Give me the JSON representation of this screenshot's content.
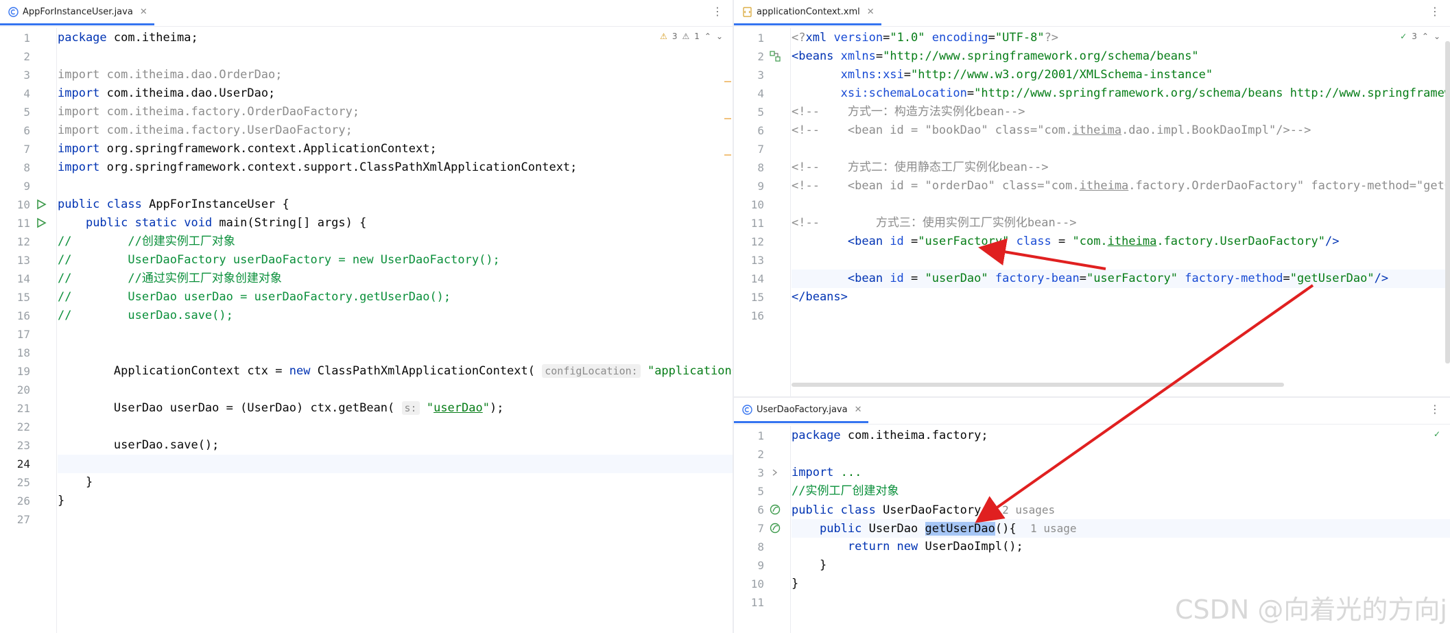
{
  "left": {
    "tab_title": "AppForInstanceUser.java",
    "inspections": {
      "warnings": "3",
      "weak_warnings": "1"
    },
    "lines": [
      {
        "n": "1",
        "segs": [
          [
            "kw",
            "package "
          ],
          [
            "",
            "com.itheima;"
          ]
        ]
      },
      {
        "n": "2",
        "segs": []
      },
      {
        "n": "3",
        "segs": [
          [
            "gray",
            "import com.itheima.dao.OrderDao;"
          ]
        ]
      },
      {
        "n": "4",
        "segs": [
          [
            "kw",
            "import "
          ],
          [
            "",
            "com.itheima.dao.UserDao;"
          ]
        ]
      },
      {
        "n": "5",
        "segs": [
          [
            "gray",
            "import com.itheima.factory.OrderDaoFactory;"
          ]
        ]
      },
      {
        "n": "6",
        "segs": [
          [
            "gray",
            "import com.itheima.factory.UserDaoFactory;"
          ]
        ]
      },
      {
        "n": "7",
        "segs": [
          [
            "kw",
            "import "
          ],
          [
            "",
            "org.springframework.context.ApplicationContext;"
          ]
        ]
      },
      {
        "n": "8",
        "segs": [
          [
            "kw",
            "import "
          ],
          [
            "",
            "org.springframework.context.support.ClassPathXmlApplicationContext;"
          ]
        ]
      },
      {
        "n": "9",
        "segs": []
      },
      {
        "n": "10",
        "segs": [
          [
            "kw",
            "public class "
          ],
          [
            "",
            "AppForInstanceUser {"
          ]
        ]
      },
      {
        "n": "11",
        "segs": [
          [
            "",
            "    "
          ],
          [
            "kw",
            "public static void "
          ],
          [
            "",
            "main(String[] args) {"
          ]
        ]
      },
      {
        "n": "12",
        "segs": [
          [
            "cmtg",
            "//        //创建实例工厂对象"
          ]
        ]
      },
      {
        "n": "13",
        "segs": [
          [
            "cmtg",
            "//        UserDaoFactory userDaoFactory = new UserDaoFactory();"
          ]
        ]
      },
      {
        "n": "14",
        "segs": [
          [
            "cmtg",
            "//        //通过实例工厂对象创建对象"
          ]
        ]
      },
      {
        "n": "15",
        "segs": [
          [
            "cmtg",
            "//        UserDao userDao = userDaoFactory.getUserDao();"
          ]
        ]
      },
      {
        "n": "16",
        "segs": [
          [
            "cmtg",
            "//        userDao.save();"
          ]
        ]
      },
      {
        "n": "17",
        "segs": []
      },
      {
        "n": "18",
        "segs": []
      },
      {
        "n": "19",
        "segs": [
          [
            "",
            "        ApplicationContext ctx = "
          ],
          [
            "kw",
            "new "
          ],
          [
            "",
            "ClassPathXmlApplicationContext( "
          ],
          [
            "hint",
            "configLocation:"
          ],
          [
            "",
            " "
          ],
          [
            "str",
            "\"applicationConte"
          ]
        ]
      },
      {
        "n": "20",
        "segs": []
      },
      {
        "n": "21",
        "segs": [
          [
            "",
            "        UserDao userDao = (UserDao) ctx.getBean( "
          ],
          [
            "hint",
            "s:"
          ],
          [
            "",
            " "
          ],
          [
            "str",
            "\""
          ],
          [
            "str ul",
            "userDao"
          ],
          [
            "str",
            "\""
          ],
          [
            "",
            ");"
          ]
        ]
      },
      {
        "n": "22",
        "segs": []
      },
      {
        "n": "23",
        "segs": [
          [
            "",
            "        userDao.save();"
          ]
        ]
      },
      {
        "n": "24",
        "segs": []
      },
      {
        "n": "25",
        "segs": [
          [
            "",
            "    }"
          ]
        ]
      },
      {
        "n": "26",
        "segs": [
          [
            "",
            "}"
          ]
        ]
      },
      {
        "n": "27",
        "segs": []
      }
    ]
  },
  "xml": {
    "tab_title": "applicationContext.xml",
    "inspections": {
      "ok": "3"
    },
    "lines": [
      {
        "n": "1",
        "segs": [
          [
            "pi",
            "<?"
          ],
          [
            "tag",
            "xml "
          ],
          [
            "attr",
            "version"
          ],
          [
            "",
            "="
          ],
          [
            "str",
            "\"1.0\" "
          ],
          [
            "attr",
            "encoding"
          ],
          [
            "",
            "="
          ],
          [
            "str",
            "\"UTF-8\""
          ],
          [
            "pi",
            "?>"
          ]
        ]
      },
      {
        "n": "2",
        "segs": [
          [
            "tag",
            "<beans "
          ],
          [
            "attr",
            "xmlns"
          ],
          [
            "",
            "="
          ],
          [
            "str",
            "\"http://www.springframework.org/schema/beans\""
          ]
        ]
      },
      {
        "n": "3",
        "segs": [
          [
            "",
            "       "
          ],
          [
            "attr",
            "xmlns:xsi"
          ],
          [
            "",
            "="
          ],
          [
            "str",
            "\"http://www.w3.org/2001/XMLSchema-instance\""
          ]
        ]
      },
      {
        "n": "4",
        "segs": [
          [
            "",
            "       "
          ],
          [
            "attr",
            "xsi:schemaLocation"
          ],
          [
            "",
            "="
          ],
          [
            "str",
            "\"http://www.springframework.org/schema/beans http://www.springframework"
          ]
        ]
      },
      {
        "n": "5",
        "segs": [
          [
            "cmt",
            "<!--    方式一：构造方法实例化bean-->"
          ]
        ]
      },
      {
        "n": "6",
        "segs": [
          [
            "cmt",
            "<!--    <bean id = \"bookDao\" class=\"com."
          ],
          [
            "cmt ul",
            "itheima"
          ],
          [
            "cmt",
            ".dao.impl.BookDaoImpl\"/>-->"
          ]
        ]
      },
      {
        "n": "7",
        "segs": []
      },
      {
        "n": "8",
        "segs": [
          [
            "cmt",
            "<!--    方式二：使用静态工厂实例化bean-->"
          ]
        ]
      },
      {
        "n": "9",
        "segs": [
          [
            "cmt",
            "<!--    <bean id = \"orderDao\" class=\"com."
          ],
          [
            "cmt ul",
            "itheima"
          ],
          [
            "cmt",
            ".factory.OrderDaoFactory\" factory-method=\"getOrde"
          ]
        ]
      },
      {
        "n": "10",
        "segs": []
      },
      {
        "n": "11",
        "segs": [
          [
            "cmt",
            "<!--        方式三：使用实例工厂实例化bean-->"
          ]
        ]
      },
      {
        "n": "12",
        "segs": [
          [
            "",
            "        "
          ],
          [
            "tag",
            "<bean "
          ],
          [
            "attr",
            "id "
          ],
          [
            "",
            "="
          ],
          [
            "str",
            "\"userFactory\" "
          ],
          [
            "attr",
            "class "
          ],
          [
            "",
            "= "
          ],
          [
            "str",
            "\"com."
          ],
          [
            "str ul",
            "itheima"
          ],
          [
            "str",
            ".factory.UserDaoFactory\""
          ],
          [
            "tag",
            "/>"
          ]
        ]
      },
      {
        "n": "13",
        "segs": []
      },
      {
        "n": "14",
        "segs": [
          [
            "",
            "        "
          ],
          [
            "tag",
            "<bean "
          ],
          [
            "attr",
            "id "
          ],
          [
            "",
            "= "
          ],
          [
            "str",
            "\"userDao\" "
          ],
          [
            "attr",
            "factory-bean"
          ],
          [
            "",
            "="
          ],
          [
            "str",
            "\"userFactory\" "
          ],
          [
            "attr",
            "factory-method"
          ],
          [
            "",
            "="
          ],
          [
            "str",
            "\"getUserDao\""
          ],
          [
            "tag",
            "/>"
          ]
        ]
      },
      {
        "n": "15",
        "segs": [
          [
            "tag",
            "</beans>"
          ]
        ]
      },
      {
        "n": "16",
        "segs": []
      }
    ]
  },
  "factory": {
    "tab_title": "UserDaoFactory.java",
    "lines": [
      {
        "n": "1",
        "segs": [
          [
            "kw",
            "package "
          ],
          [
            "",
            "com.itheima.factory;"
          ]
        ]
      },
      {
        "n": "2",
        "segs": []
      },
      {
        "n": "3",
        "segs": [
          [
            "kw",
            "import "
          ],
          [
            "str",
            "..."
          ]
        ]
      },
      {
        "n": "5",
        "segs": [
          [
            "cmtg",
            "//实例工厂创建对象"
          ]
        ]
      },
      {
        "n": "6",
        "segs": [
          [
            "kw",
            "public class "
          ],
          [
            "",
            "UserDaoFactory { "
          ],
          [
            "uhint",
            "2 usages"
          ]
        ]
      },
      {
        "n": "7",
        "segs": [
          [
            "",
            "    "
          ],
          [
            "kw",
            "public "
          ],
          [
            "",
            "UserDao "
          ],
          [
            "sel",
            "getUserDao"
          ],
          [
            "",
            "(){  "
          ],
          [
            "uhint",
            "1 usage"
          ]
        ]
      },
      {
        "n": "8",
        "segs": [
          [
            "",
            "        "
          ],
          [
            "kw",
            "return new "
          ],
          [
            "",
            "UserDaoImpl();"
          ]
        ]
      },
      {
        "n": "9",
        "segs": [
          [
            "",
            "    }"
          ]
        ]
      },
      {
        "n": "10",
        "segs": [
          [
            "",
            "}"
          ]
        ]
      },
      {
        "n": "11",
        "segs": []
      }
    ]
  },
  "watermark": "CSDN @向着光的方向j",
  "colors": {
    "keyword": "#0033b3",
    "string": "#067d17",
    "comment": "#8c8c8c",
    "arrow": "#e02020"
  }
}
